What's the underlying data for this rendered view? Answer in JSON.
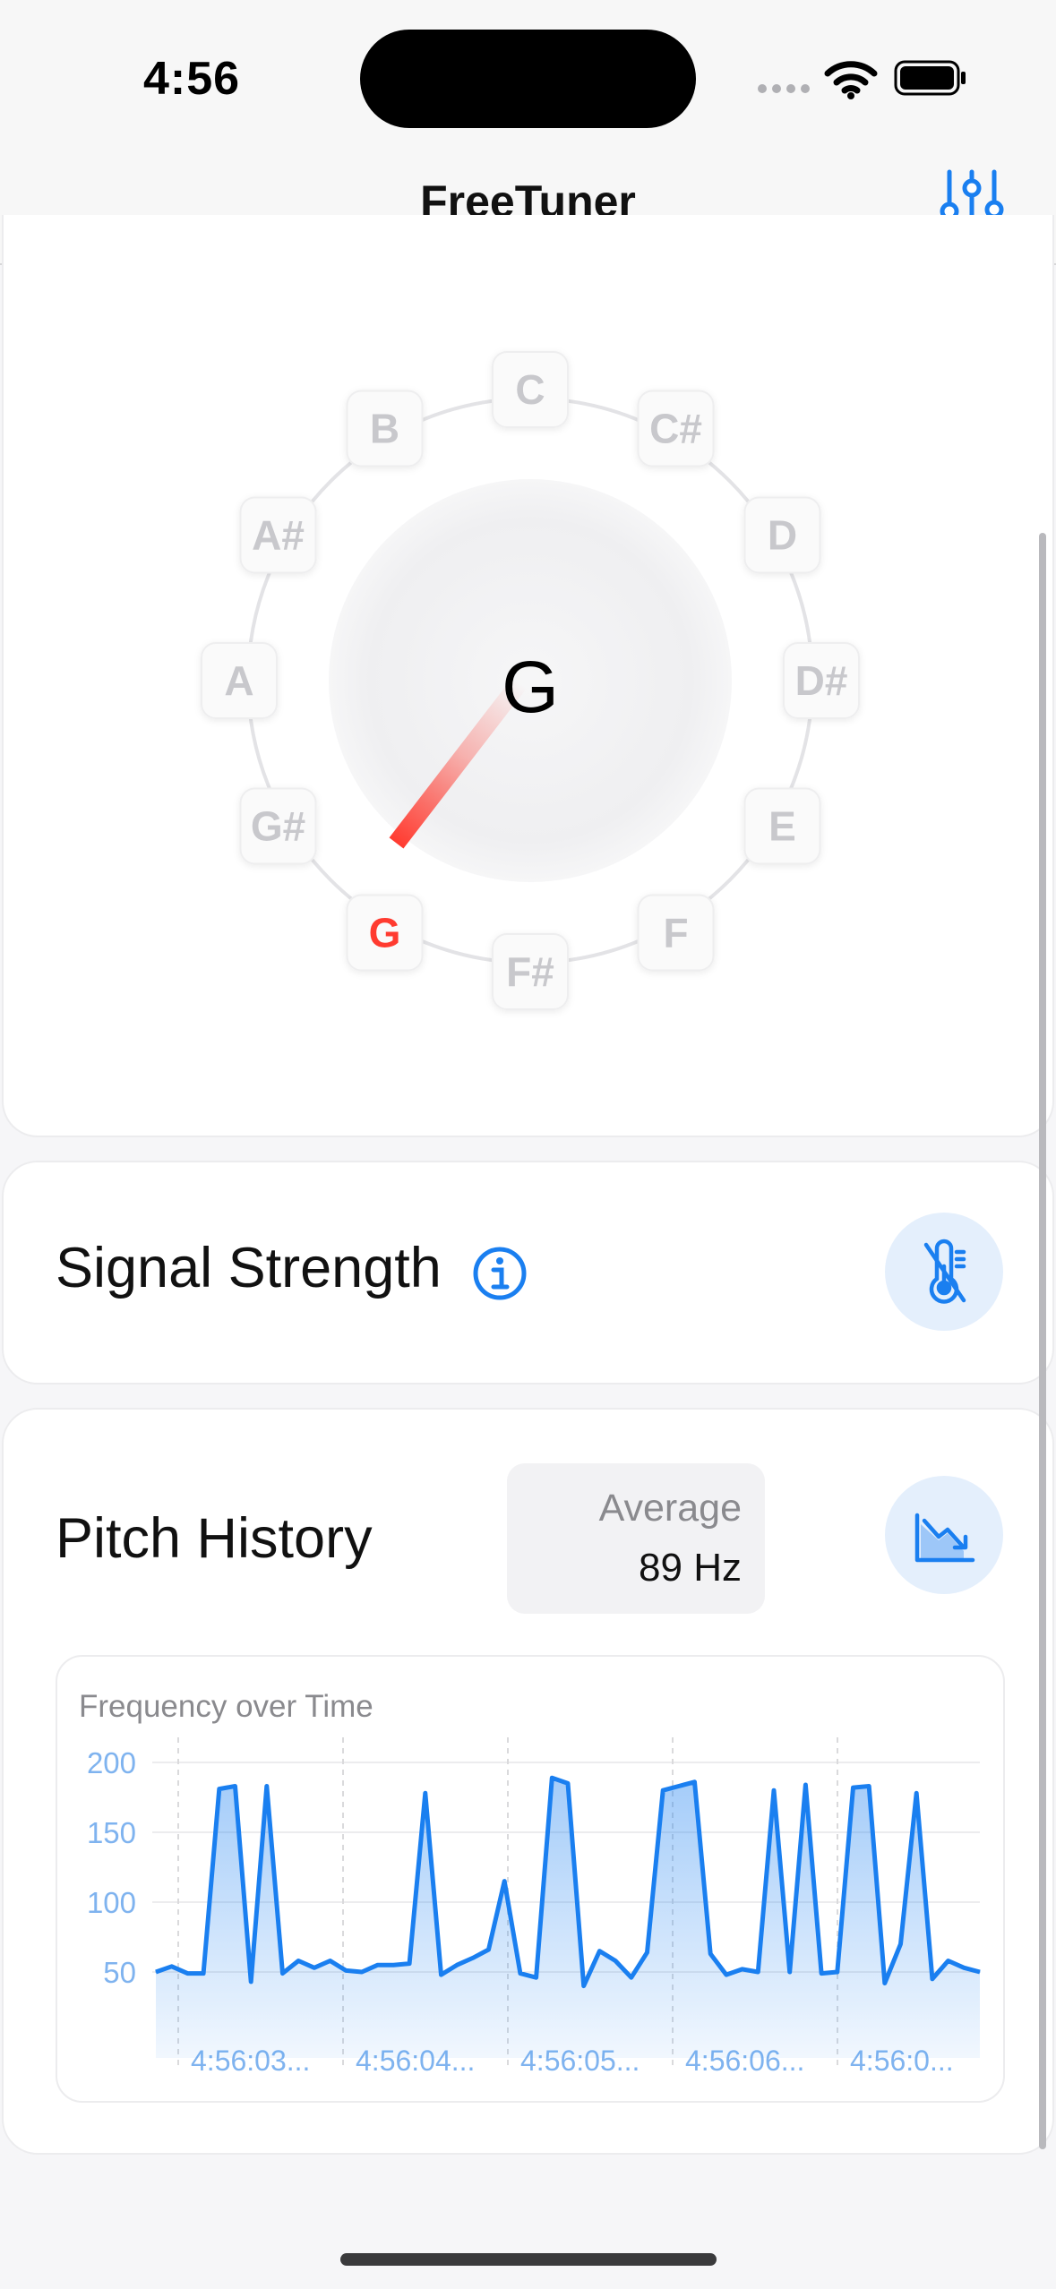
{
  "status_bar": {
    "time": "4:56"
  },
  "nav": {
    "title": "FreeTuner",
    "settings_icon": "sliders-icon"
  },
  "tuner": {
    "current_note": "G",
    "highlighted_note": "G",
    "notes": [
      "C",
      "C#",
      "D",
      "D#",
      "E",
      "F",
      "F#",
      "G",
      "G#",
      "A",
      "A#",
      "B"
    ],
    "colors": {
      "needle": "#ff3b30",
      "highlight": "#ff3b30",
      "inactive_note": "#c8c8cc"
    }
  },
  "signal": {
    "title": "Signal Strength",
    "info_icon": "info-circle-icon",
    "button_icon": "thermometer-slash-icon"
  },
  "history": {
    "title": "Pitch History",
    "average_label": "Average",
    "average_value": "89 Hz",
    "button_icon": "chart-line-downtrend-icon"
  },
  "chart_data": {
    "type": "area",
    "title": "Frequency over Time",
    "xlabel": "",
    "ylabel": "",
    "ylim": [
      0,
      200
    ],
    "yticks": [
      50,
      100,
      150,
      200
    ],
    "x_tick_labels": [
      "4:56:03...",
      "4:56:04...",
      "4:56:05...",
      "4:56:06...",
      "4:56:0..."
    ],
    "grid": true,
    "color": "#1a7ff0",
    "series": [
      {
        "values": [
          50,
          54,
          49,
          49,
          181,
          183,
          43,
          183,
          49,
          58,
          53,
          58,
          51,
          50,
          55,
          55,
          56,
          178,
          48,
          55,
          60,
          66,
          115,
          49,
          46,
          189,
          185,
          40,
          65,
          58,
          46,
          64,
          180,
          183,
          186,
          63,
          48,
          52,
          50,
          180,
          50,
          184,
          49,
          50,
          182,
          183,
          42,
          70,
          178,
          45,
          58,
          53,
          50
        ]
      }
    ]
  }
}
